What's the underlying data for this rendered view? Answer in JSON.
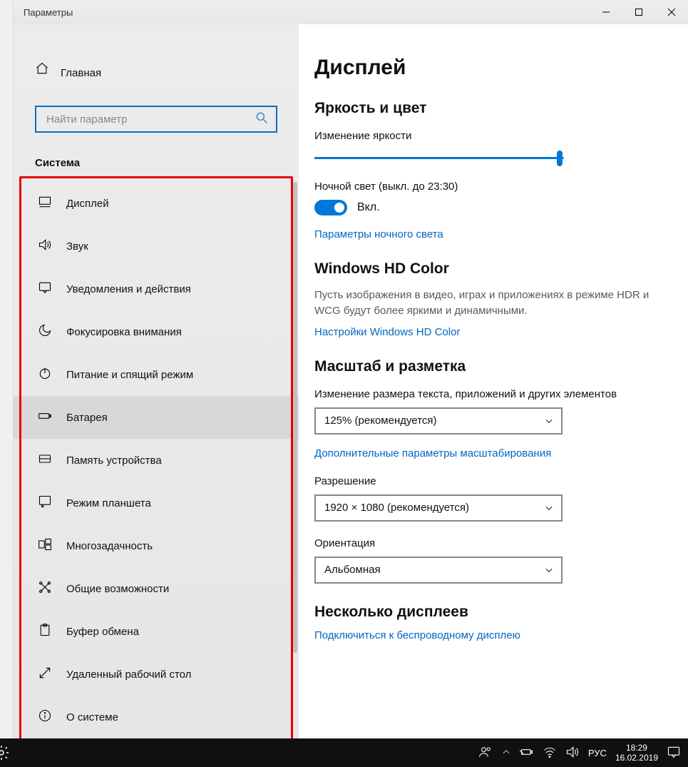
{
  "window_title": "Параметры",
  "home_label": "Главная",
  "search_placeholder": "Найти параметр",
  "section_title": "Система",
  "nav_items": [
    {
      "label": "Дисплей",
      "icon": "display-icon"
    },
    {
      "label": "Звук",
      "icon": "sound-icon"
    },
    {
      "label": "Уведомления и действия",
      "icon": "notifications-icon"
    },
    {
      "label": "Фокусировка внимания",
      "icon": "focus-icon"
    },
    {
      "label": "Питание и спящий режим",
      "icon": "power-icon"
    },
    {
      "label": "Батарея",
      "icon": "battery-icon"
    },
    {
      "label": "Память устройства",
      "icon": "storage-icon"
    },
    {
      "label": "Режим планшета",
      "icon": "tablet-icon"
    },
    {
      "label": "Многозадачность",
      "icon": "multitask-icon"
    },
    {
      "label": "Общие возможности",
      "icon": "shared-icon"
    },
    {
      "label": "Буфер обмена",
      "icon": "clipboard-icon"
    },
    {
      "label": "Удаленный рабочий стол",
      "icon": "remote-icon"
    },
    {
      "label": "О системе",
      "icon": "about-icon"
    }
  ],
  "selected_nav_index": 5,
  "content": {
    "heading": "Дисплей",
    "brightness_section": "Яркость и цвет",
    "brightness_label": "Изменение яркости",
    "nightlight_label": "Ночной свет (выкл. до 23:30)",
    "toggle_on": "Вкл.",
    "nightlight_link": "Параметры ночного света",
    "hdcolor_title": "Windows HD Color",
    "hdcolor_desc": "Пусть изображения в видео, играх и приложениях в режиме HDR и WCG будут более яркими и динамичными.",
    "hdcolor_link": "Настройки Windows HD Color",
    "scale_title": "Масштаб и разметка",
    "scale_label": "Изменение размера текста, приложений и других элементов",
    "scale_value": "125% (рекомендуется)",
    "scale_link": "Дополнительные параметры масштабирования",
    "resolution_label": "Разрешение",
    "resolution_value": "1920 × 1080 (рекомендуется)",
    "orientation_label": "Ориентация",
    "orientation_value": "Альбомная",
    "multidisp_title": "Несколько дисплеев",
    "multidisp_link": "Подключиться к беспроводному дисплею"
  },
  "taskbar": {
    "lang": "РУС",
    "time": "18:29",
    "date": "16.02.2019"
  }
}
